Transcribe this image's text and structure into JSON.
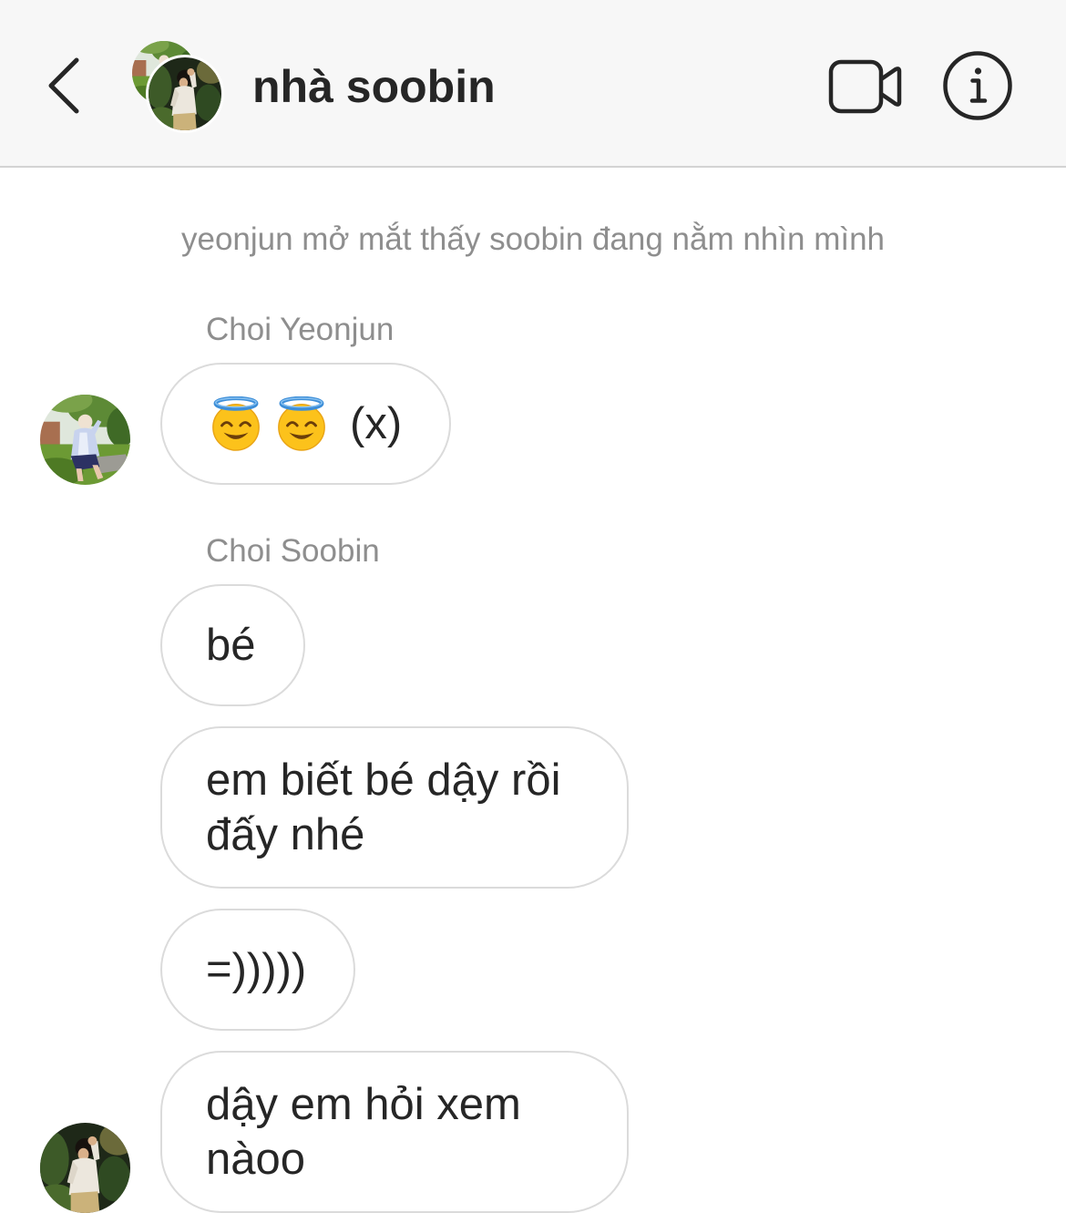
{
  "header": {
    "back_icon": "chevron-left-icon",
    "title": "nhà soobin",
    "video_call_icon": "video-camera-icon",
    "info_icon": "info-icon"
  },
  "thread": {
    "system_message": "yeonjun mở mắt thấy soobin đang nằm nhìn mình",
    "groups": [
      {
        "sender": "Choi Yeonjun",
        "messages": [
          {
            "emoji_icons": [
              "smiling-face-with-halo-icon",
              "smiling-face-with-halo-icon"
            ],
            "text": "(x)"
          }
        ]
      },
      {
        "sender": "Choi Soobin",
        "messages": [
          {
            "text": "bé"
          },
          {
            "text": "em biết bé dậy rồi đấy nhé"
          },
          {
            "text": "=)))))"
          },
          {
            "text": "dậy em hỏi xem nàoo"
          }
        ]
      }
    ]
  },
  "colors": {
    "header_background": "#f7f7f7",
    "text_primary": "#262626",
    "text_secondary": "#8e8e8e",
    "bubble_border": "#dbdbdb"
  }
}
